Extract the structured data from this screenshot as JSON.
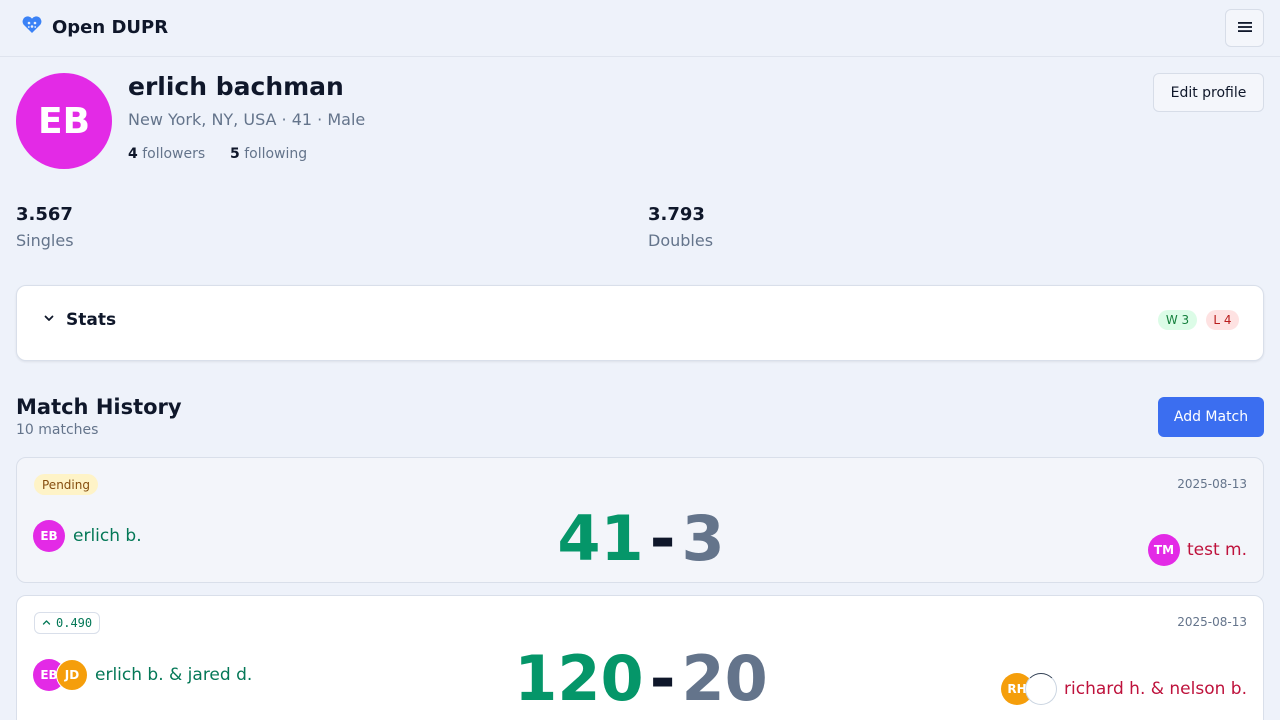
{
  "header": {
    "app_name": "Open DUPR"
  },
  "profile": {
    "initials": "EB",
    "name": "erlich bachman",
    "meta": "New York, NY, USA · 41 · Male",
    "followers_count": "4",
    "followers_label": "followers",
    "following_count": "5",
    "following_label": "following",
    "edit_label": "Edit profile",
    "avatar_color": "#e32ae6"
  },
  "ratings": {
    "singles": {
      "value": "3.567",
      "label": "Singles"
    },
    "doubles": {
      "value": "3.793",
      "label": "Doubles"
    }
  },
  "stats": {
    "title": "Stats",
    "wins": "W 3",
    "losses": "L 4"
  },
  "match_history": {
    "title": "Match History",
    "count": "10 matches",
    "add_label": "Add Match",
    "matches": [
      {
        "badge": "Pending",
        "date": "2025-08-13",
        "team1": {
          "avatars": [
            "EB"
          ],
          "names": "erlich b."
        },
        "team2": {
          "avatars": [
            "TM"
          ],
          "names": "test m."
        },
        "score1": "41",
        "separator": "-",
        "score2": "3"
      },
      {
        "delta": "0.490",
        "date": "2025-08-13",
        "team1": {
          "avatars": [
            "EB",
            "JD"
          ],
          "names": "erlich b. & jared d."
        },
        "team2": {
          "avatars": [
            "RH",
            ""
          ],
          "names": "richard h. & nelson b."
        },
        "score1": "120",
        "separator": "-",
        "score2": "20"
      }
    ]
  },
  "colors": {
    "primary": "#3b6ef0",
    "win": "#059669",
    "loss": "#be123c",
    "avatar_pink": "#e32ae6",
    "avatar_orange": "#f59e0b"
  }
}
